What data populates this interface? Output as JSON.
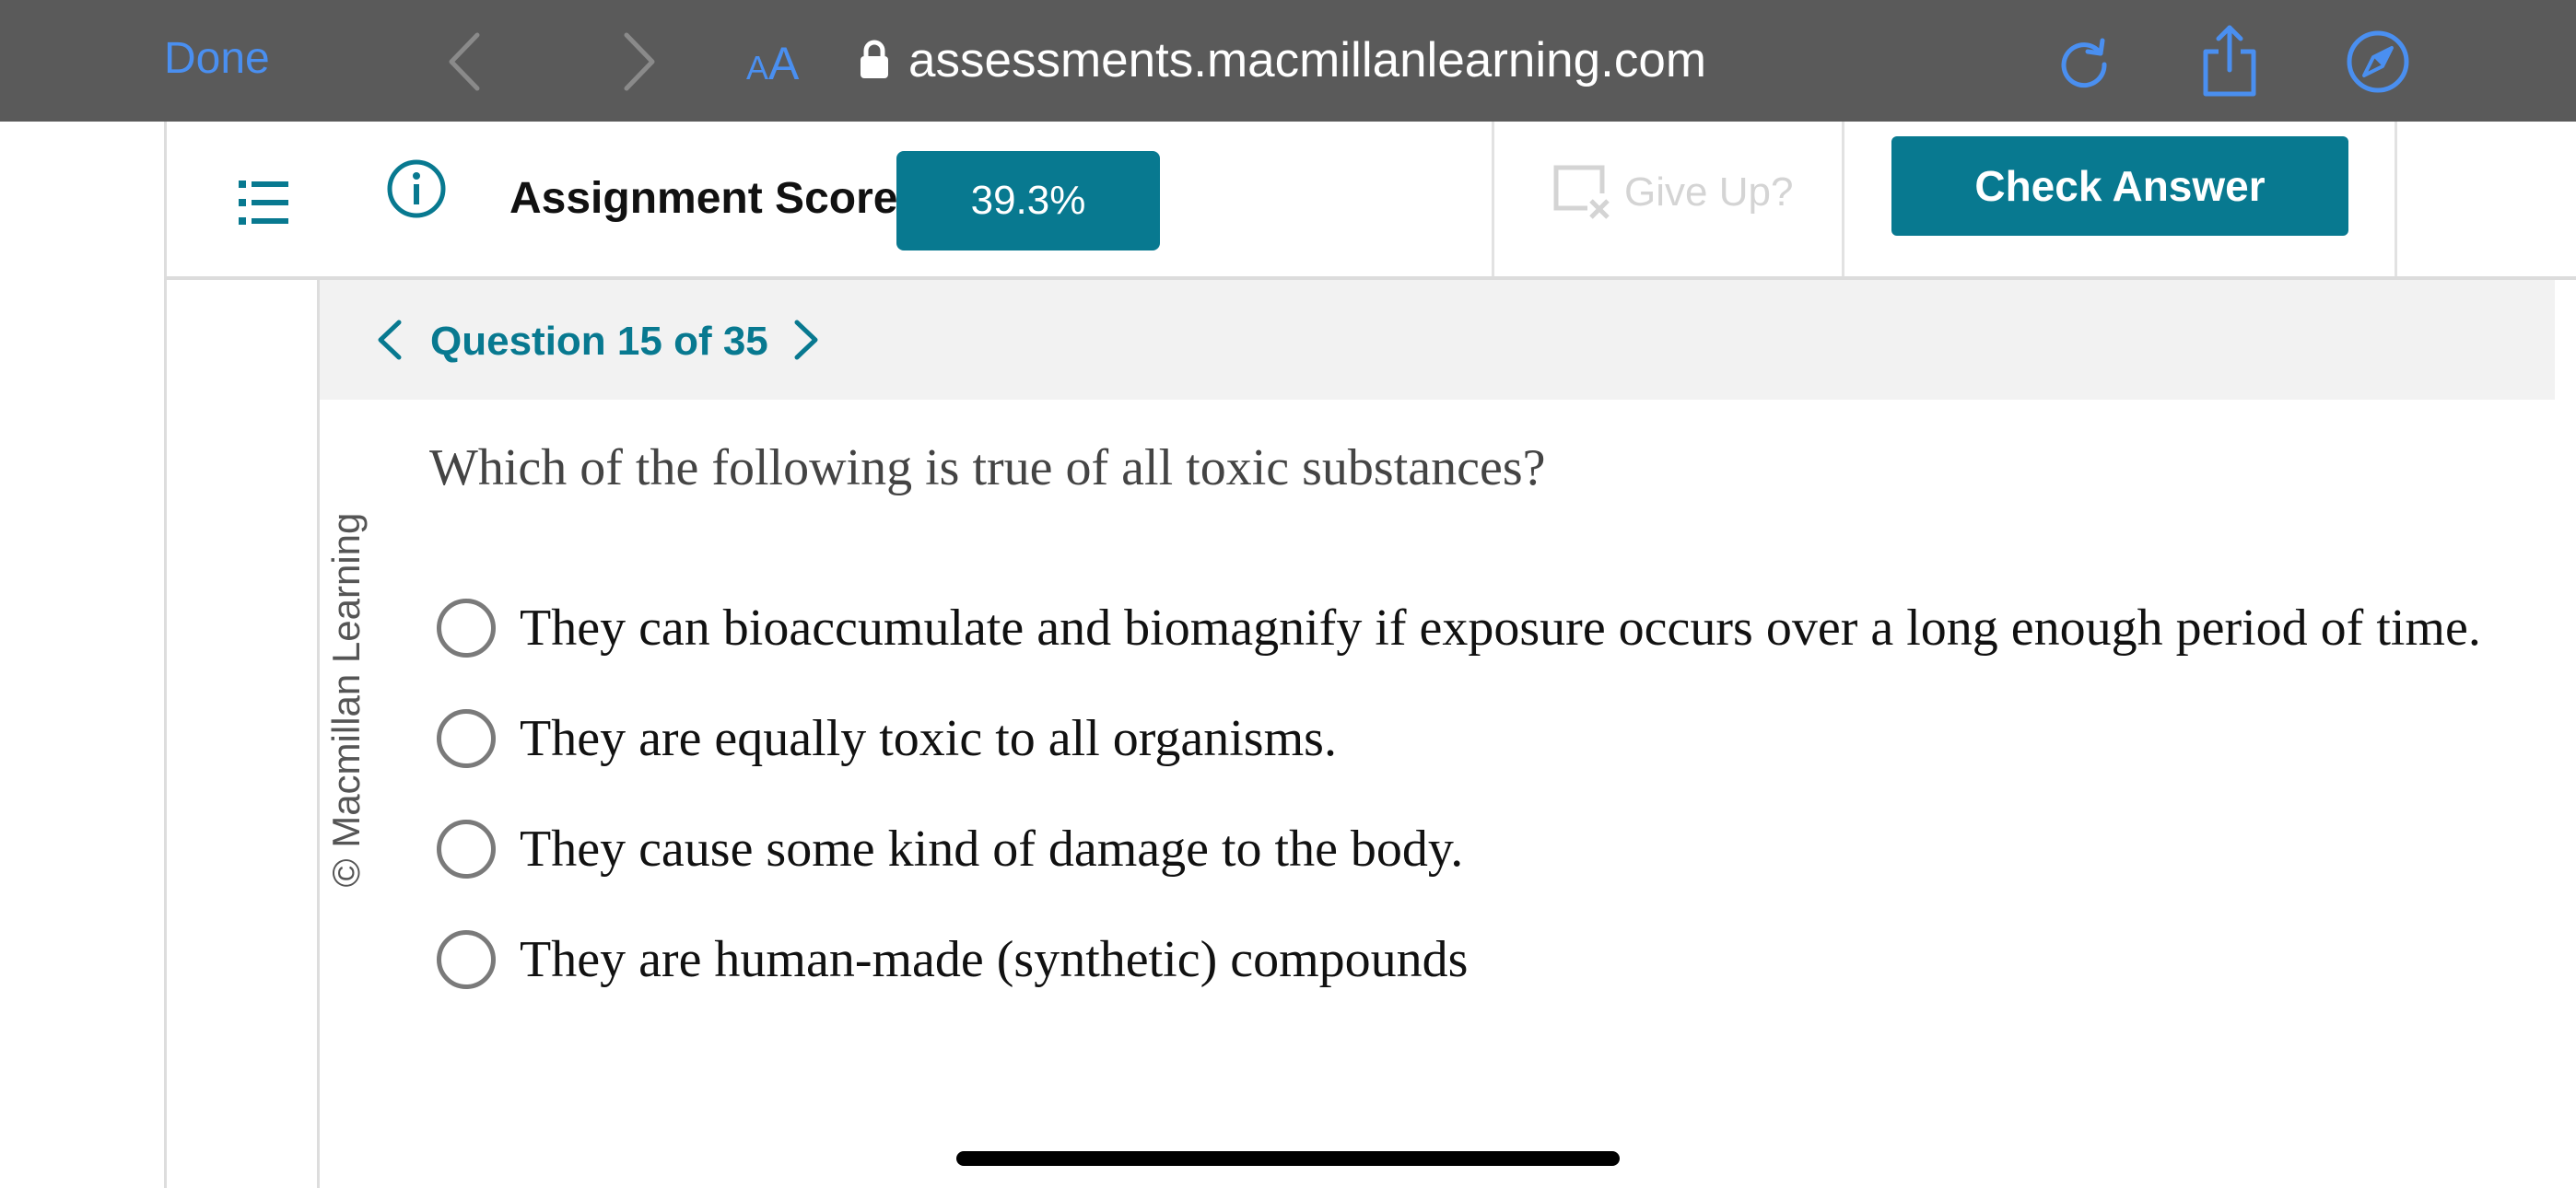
{
  "browser": {
    "done_label": "Done",
    "text_size_small": "A",
    "text_size_big": "A",
    "url": "assessments.macmillanlearning.com",
    "link_color": "#4a8ff0"
  },
  "header": {
    "score_label": "Assignment Score:",
    "score_value": "39.3%",
    "give_up_label": "Give Up?",
    "check_answer_label": "Check Answer",
    "accent_color": "#087990"
  },
  "sidebar": {
    "copyright": "© Macmillan Learning"
  },
  "question": {
    "nav_label": "Question 15 of 35",
    "text": "Which of the following is true of all toxic substances?",
    "options": [
      {
        "label": "They can bioaccumulate and biomagnify if exposure occurs over a long enough period of time."
      },
      {
        "label": "They are equally toxic to all organisms."
      },
      {
        "label": "They cause some kind of damage to the body."
      },
      {
        "label": "They are human-made (synthetic) compounds"
      }
    ]
  }
}
